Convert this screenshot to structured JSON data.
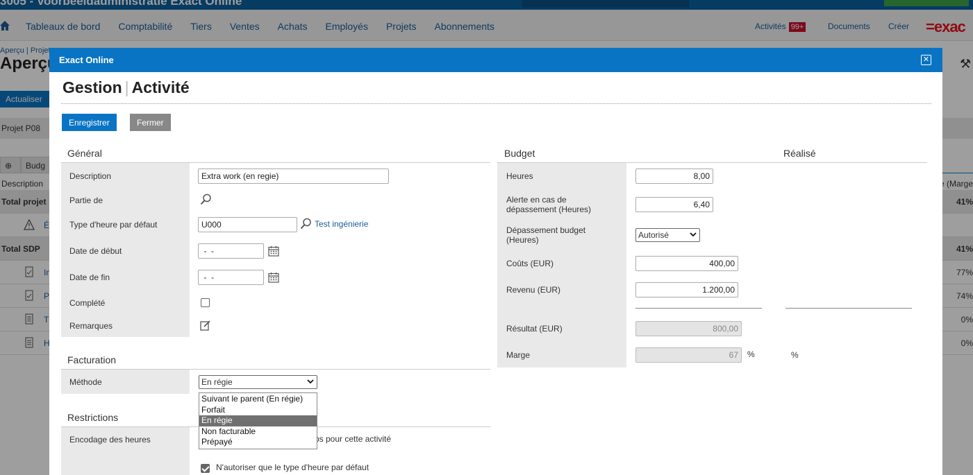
{
  "background": {
    "app_title": "3005 - Voorbeeldadministratie Exact Online",
    "nav": [
      "Tableaux de bord",
      "Comptabilité",
      "Tiers",
      "Ventes",
      "Achats",
      "Employés",
      "Projets",
      "Abonnements"
    ],
    "nav_right": {
      "activities": "Activités",
      "activities_badge": "99+",
      "documents": "Documents",
      "create": "Créer"
    },
    "logo": "=exac",
    "breadcrumb": "Aperçu | Projet",
    "heading": "Aperçu",
    "refresh": "Actualiser",
    "project": "Projet  P08",
    "tab_icon": "⊕",
    "tab_budget": "Budg",
    "col_description": "Description",
    "col_margin": "e (Marge",
    "rows": [
      {
        "label": "Total projet",
        "right": "41%"
      },
      {
        "label": "É",
        "right": ""
      },
      {
        "label": "Total SDP",
        "right": "41%"
      },
      {
        "label": "In",
        "right": "77%"
      },
      {
        "label": "P",
        "right": "74%"
      },
      {
        "label": "T",
        "right": "0%"
      },
      {
        "label": "H",
        "right": "0%"
      }
    ]
  },
  "modal": {
    "header_title": "Exact Online",
    "title_part1": "Gestion",
    "title_part2": "Activité",
    "save_label": "Enregistrer",
    "close_label": "Fermer"
  },
  "general": {
    "section": "Général",
    "description_label": "Description",
    "description_value": "Extra work (en regie)",
    "part_of_label": "Partie de",
    "hour_type_label": "Type d'heure par défaut",
    "hour_type_value": "U000",
    "hour_type_link": "Test ingénierie",
    "start_date_label": "Date de début",
    "start_date_value": " -  -",
    "end_date_label": "Date de fin",
    "end_date_value": " -  -",
    "completed_label": "Complété",
    "remarks_label": "Remarques"
  },
  "billing": {
    "section": "Facturation",
    "method_label": "Méthode",
    "method_value": "En régie",
    "options": [
      "Suivant le parent (En régie)",
      "Forfait",
      "En régie",
      "Non facturable",
      "Prépayé"
    ],
    "selected_index": 2
  },
  "restrictions": {
    "section": "Restrictions",
    "hours_label": "Encodage des heures",
    "partial_text": "ps pour cette activité",
    "only_default_label": "N'autoriser que le type d'heure par défaut"
  },
  "budget": {
    "section": "Budget",
    "realized_section": "Réalisé",
    "hours_label": "Heures",
    "hours_value": "8,00",
    "alert_label_1": "Alerte en cas de",
    "alert_label_2": "dépassement (Heures)",
    "alert_value": "6,40",
    "overrun_label_1": "Dépassement budget",
    "overrun_label_2": "(Heures)",
    "overrun_value": "Autorisé",
    "costs_label": "Coûts (EUR)",
    "costs_value": "400,00",
    "revenue_label": "Revenu (EUR)",
    "revenue_value": "1.200,00",
    "result_label": "Résultat (EUR)",
    "result_value": "800,00",
    "margin_label": "Marge",
    "margin_value": "67",
    "percent": "%",
    "realized_percent": "%"
  }
}
